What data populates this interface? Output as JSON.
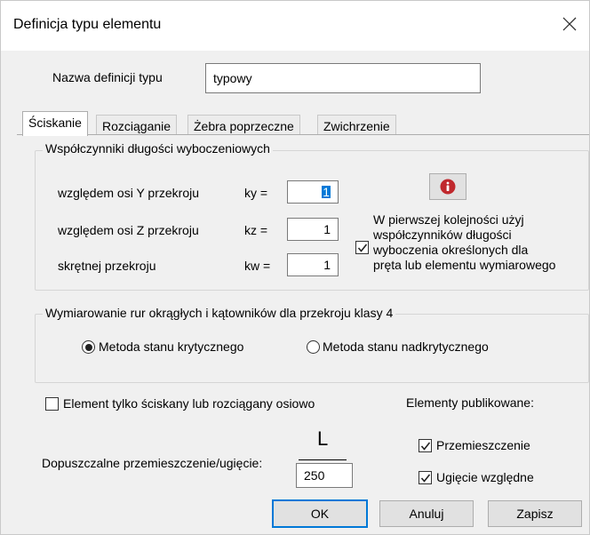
{
  "window": {
    "title": "Definicja typu elementu"
  },
  "name_definition": {
    "label": "Nazwa definicji typu",
    "value": "typowy"
  },
  "tabs": [
    {
      "label": "Ściskanie",
      "active": true
    },
    {
      "label": "Rozciąganie",
      "active": false
    },
    {
      "label": "Żebra poprzeczne",
      "active": false
    },
    {
      "label": "Zwichrzenie",
      "active": false
    }
  ],
  "buckling_group": {
    "legend": "Współczynniki długości wyboczeniowych",
    "rows": [
      {
        "label": "względem osi Y przekroju",
        "coef": "ky =",
        "value": "1"
      },
      {
        "label": "względem osi Z przekroju",
        "coef": "kz =",
        "value": "1"
      },
      {
        "label": "skrętnej przekroju",
        "coef": "kw =",
        "value": "1"
      }
    ],
    "info_icon": "info-icon",
    "priority_checkbox": {
      "checked": true,
      "lines": [
        "W pierwszej kolejności użyj",
        "współczynników długości",
        "wyboczenia określonych dla",
        "pręta lub elementu wymiarowego"
      ]
    }
  },
  "pipe_group": {
    "legend": "Wymiarowanie rur okrągłych i kątowników dla przekroju klasy 4",
    "options": [
      {
        "label": "Metoda stanu krytycznego",
        "selected": true
      },
      {
        "label": "Metoda stanu nadkrytycznego",
        "selected": false
      }
    ]
  },
  "axial_only": {
    "label": "Element tylko ściskany lub rozciągany osiowo",
    "checked": false
  },
  "published": {
    "heading": "Elementy publikowane:",
    "items": [
      {
        "label": "Przemieszczenie",
        "checked": true
      },
      {
        "label": "Ugięcie względne",
        "checked": true
      }
    ]
  },
  "deflection": {
    "label": "Dopuszczalne przemieszczenie/ugięcie:",
    "numerator": "L",
    "value": "250"
  },
  "buttons": {
    "ok": "OK",
    "cancel": "Anuluj",
    "save": "Zapisz"
  },
  "colors": {
    "accent": "#0078d7",
    "info_red": "#c0282d",
    "dialog_bg": "#f0f0f0"
  }
}
